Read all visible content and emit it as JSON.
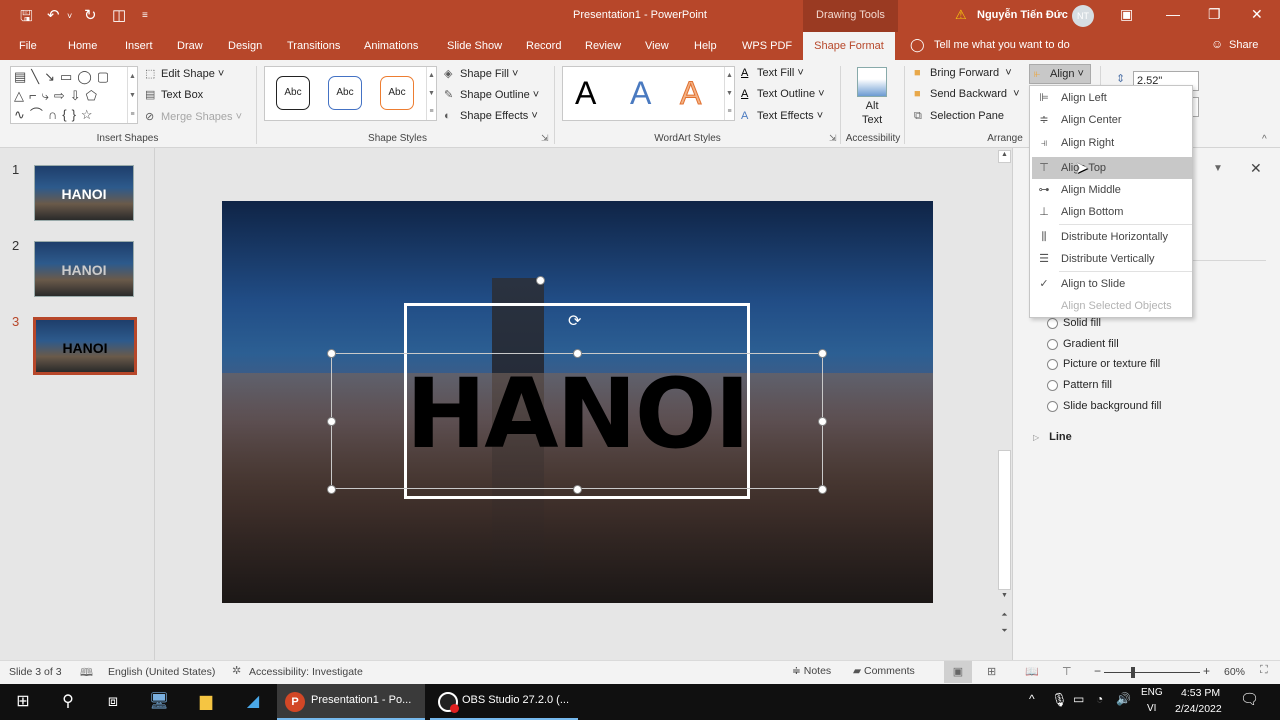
{
  "window": {
    "title": "Presentation1  -  PowerPoint",
    "context_tab_group": "Drawing Tools",
    "user_name": "Nguyễn Tiến Đức",
    "user_initials": "NT",
    "accent_color": "#b7472a"
  },
  "quick_access": {
    "save": "save-icon",
    "undo": "undo-icon",
    "redo": "redo-icon",
    "present": "present-from-start-icon",
    "customize": "customize-icon"
  },
  "tabs": [
    "File",
    "Home",
    "Insert",
    "Draw",
    "Design",
    "Transitions",
    "Animations",
    "Slide Show",
    "Record",
    "Review",
    "View",
    "Help",
    "WPS PDF",
    "Shape Format"
  ],
  "active_tab": "Shape Format",
  "tell_me": "Tell me what you want to do",
  "share": "Share",
  "ribbon": {
    "insert_shapes": {
      "label": "Insert Shapes",
      "edit_shape": "Edit Shape",
      "text_box": "Text Box",
      "merge_shapes": "Merge Shapes"
    },
    "shape_styles": {
      "label": "Shape Styles",
      "presets": [
        "Abc",
        "Abc",
        "Abc"
      ],
      "preset_colors": [
        "#222222",
        "#4472c4",
        "#ed7d31"
      ],
      "shape_fill": "Shape Fill",
      "shape_outline": "Shape Outline",
      "shape_effects": "Shape Effects"
    },
    "wordart_styles": {
      "label": "WordArt Styles",
      "presets": [
        "A",
        "A",
        "A"
      ],
      "text_fill": "Text Fill",
      "text_outline": "Text Outline",
      "text_effects": "Text Effects"
    },
    "accessibility": {
      "label": "Accessibility",
      "alt_text_1": "Alt",
      "alt_text_2": "Text"
    },
    "arrange": {
      "label": "Arrange",
      "bring_forward": "Bring Forward",
      "send_backward": "Send Backward",
      "selection_pane": "Selection Pane",
      "align": "Align"
    },
    "size": {
      "height": "2.52\"",
      "width": ""
    }
  },
  "align_menu": {
    "items": [
      {
        "label": "Align Left",
        "icon": "align-left-icon",
        "state": "normal"
      },
      {
        "label": "Align Center",
        "icon": "align-center-icon",
        "state": "normal"
      },
      {
        "label": "Align Right",
        "icon": "align-right-icon",
        "state": "normal"
      },
      {
        "label": "Align Top",
        "icon": "align-top-icon",
        "state": "hover"
      },
      {
        "label": "Align Middle",
        "icon": "align-middle-icon",
        "state": "normal"
      },
      {
        "label": "Align Bottom",
        "icon": "align-bottom-icon",
        "state": "normal"
      },
      {
        "label": "Distribute Horizontally",
        "icon": "distribute-horizontally-icon",
        "state": "normal"
      },
      {
        "label": "Distribute Vertically",
        "icon": "distribute-vertically-icon",
        "state": "normal"
      },
      {
        "label": "Align to Slide",
        "icon": "check-icon",
        "state": "checked"
      },
      {
        "label": "Align Selected Objects",
        "icon": "",
        "state": "disabled"
      }
    ]
  },
  "slides": [
    {
      "number": "1",
      "text": "HANOI"
    },
    {
      "number": "2",
      "text": "HANOI"
    },
    {
      "number": "3",
      "text": "HANOI",
      "selected": true
    }
  ],
  "slide": {
    "title_text": "HANOI"
  },
  "format_pane": {
    "fill_options": [
      "Solid fill",
      "Gradient fill",
      "Picture or texture fill",
      "Pattern fill",
      "Slide background fill"
    ],
    "line_section": "Line"
  },
  "status_bar": {
    "slide_info": "Slide 3 of 3",
    "language": "English (United States)",
    "accessibility": "Accessibility: Investigate",
    "notes": "Notes",
    "comments": "Comments",
    "zoom_minus": "−",
    "zoom_plus": "+",
    "zoom": "60%",
    "zoom_fraction": 0.6
  },
  "taskbar": {
    "apps": [
      {
        "label": "Presentation1 - Po...",
        "active": true
      },
      {
        "label": "OBS Studio 27.2.0 (...",
        "active": false
      }
    ],
    "lang_1": "ENG",
    "lang_2": "VI",
    "time": "4:53 PM",
    "date": "2/24/2022"
  }
}
